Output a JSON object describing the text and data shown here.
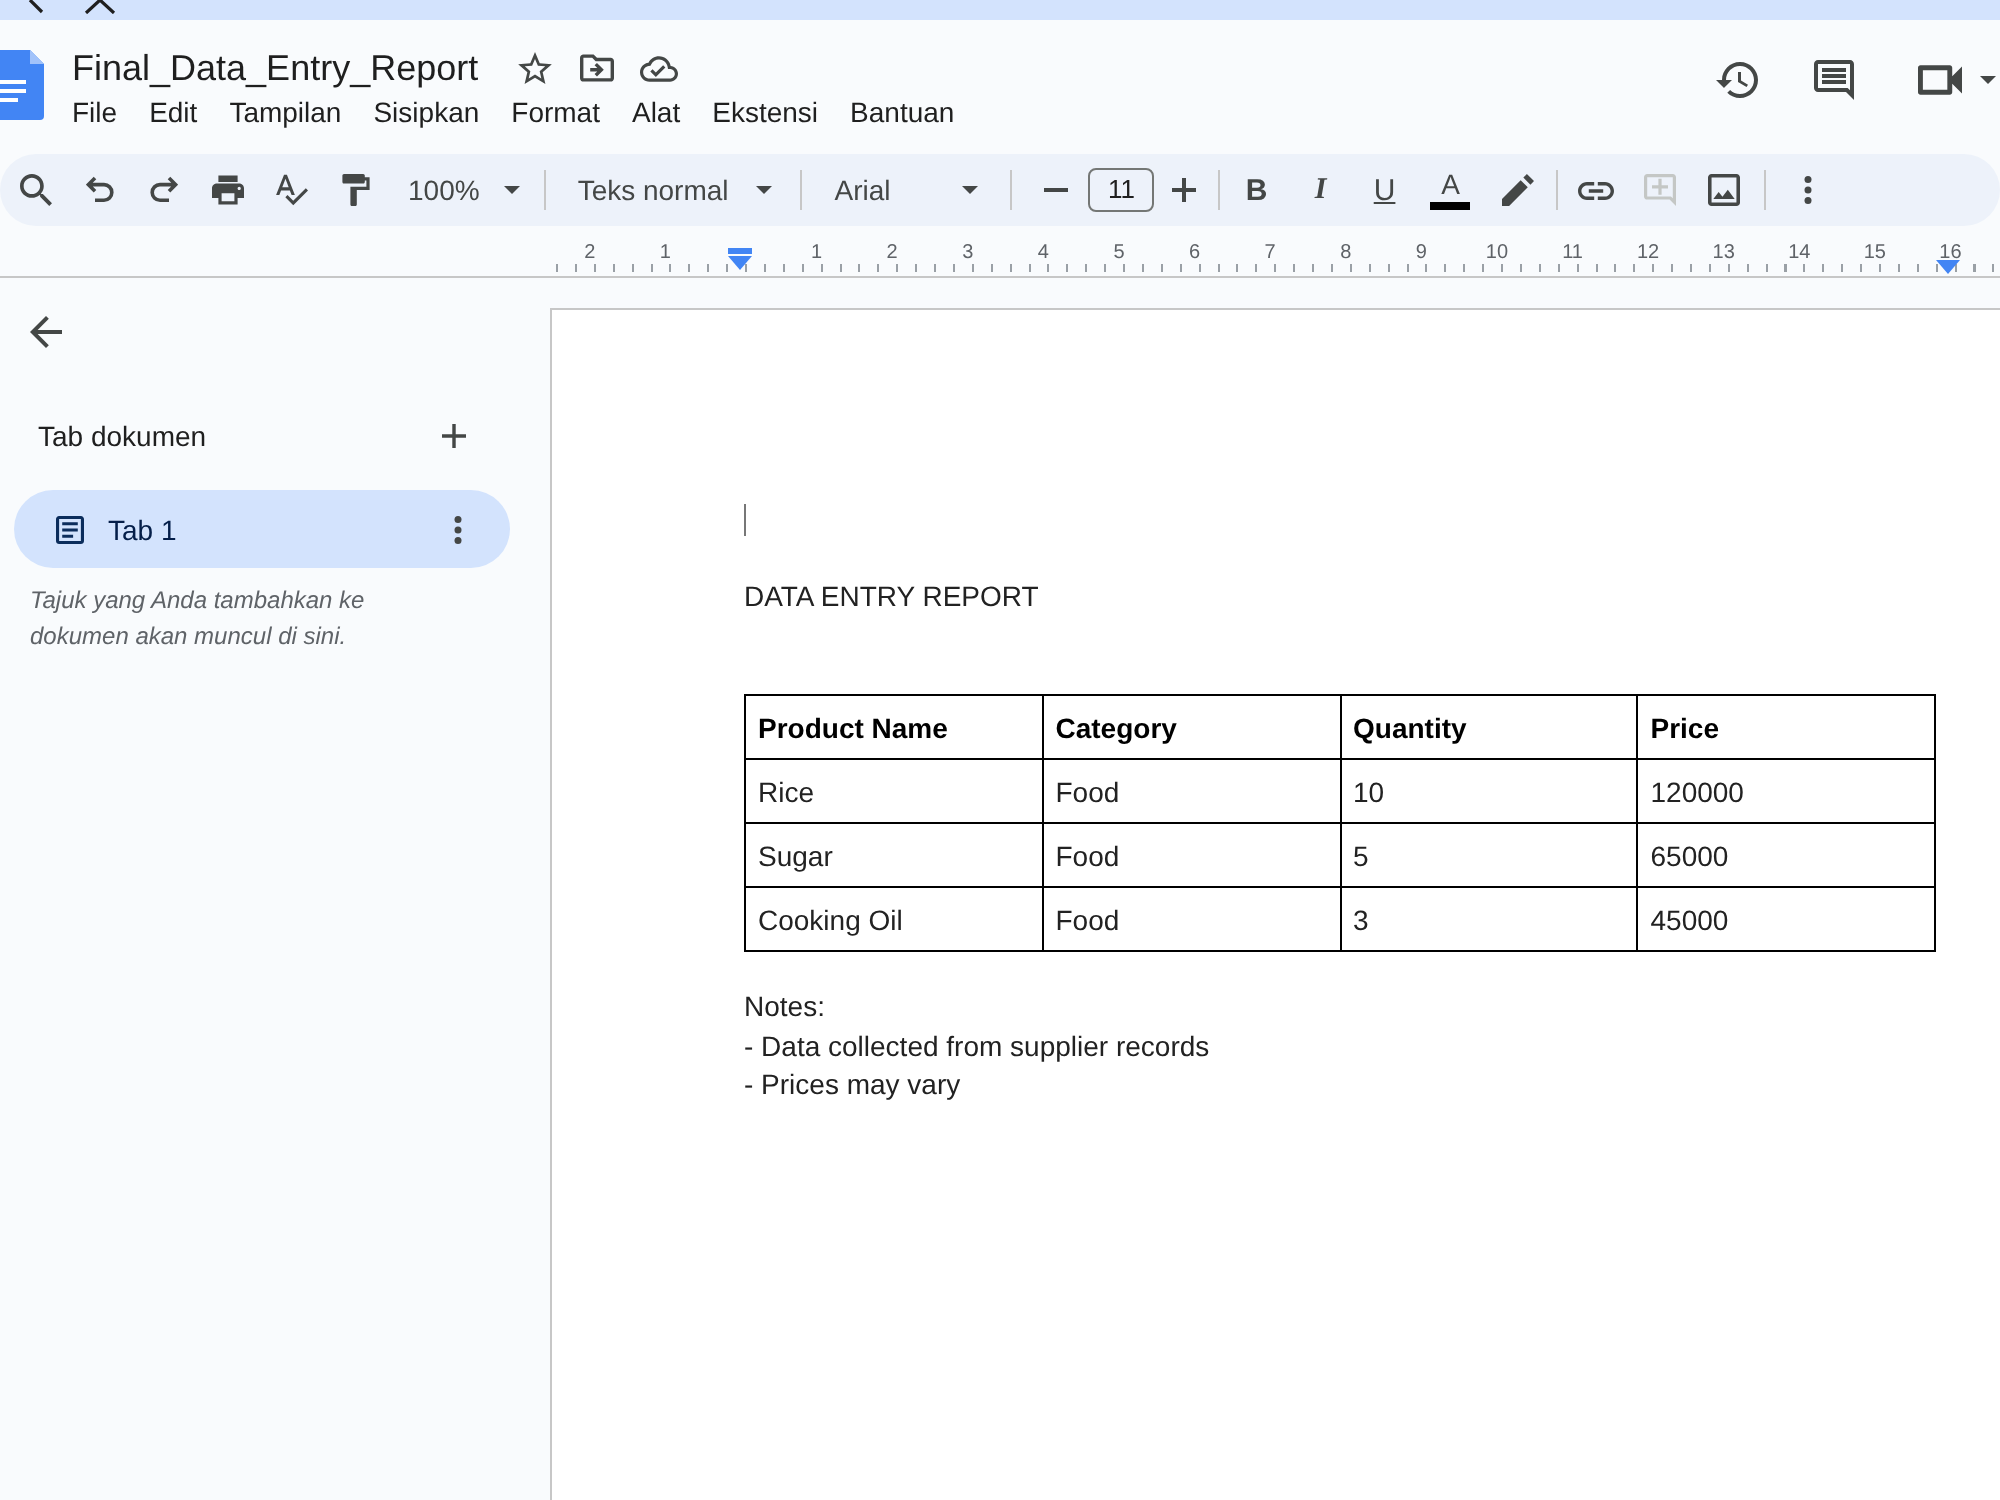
{
  "header": {
    "title": "Final_Data_Entry_Report",
    "menu": [
      "File",
      "Edit",
      "Tampilan",
      "Sisipkan",
      "Format",
      "Alat",
      "Ekstensi",
      "Bantuan"
    ]
  },
  "toolbar": {
    "zoom": "100%",
    "paragraph_style": "Teks normal",
    "font": "Arial",
    "font_size": "11",
    "bold": "B",
    "italic": "I",
    "underline": "U",
    "text_color": {
      "label": "A",
      "color": "#000000"
    },
    "add_comment": {
      "disabled": true
    }
  },
  "ruler": {
    "left_numbers": [
      "2",
      "1"
    ],
    "numbers": [
      "1",
      "2",
      "3",
      "4",
      "5",
      "6",
      "7",
      "8",
      "9",
      "10",
      "11",
      "12",
      "13",
      "14",
      "15",
      "16"
    ]
  },
  "sidebar": {
    "heading": "Tab dokumen",
    "tabs": [
      {
        "label": "Tab 1",
        "selected": true
      }
    ],
    "hint": "Tajuk yang Anda tambahkan ke dokumen akan muncul di sini."
  },
  "document": {
    "title": "DATA ENTRY REPORT",
    "table": {
      "columns": [
        "Product Name",
        "Category",
        "Quantity",
        "Price"
      ],
      "rows": [
        [
          "Rice",
          "Food",
          "10",
          "120000"
        ],
        [
          "Sugar",
          "Food",
          "5",
          "65000"
        ],
        [
          "Cooking Oil",
          "Food",
          "3",
          "45000"
        ]
      ]
    },
    "notes": {
      "heading": "Notes:",
      "items": [
        "- Data collected from supplier records",
        "- Prices may vary"
      ]
    }
  }
}
